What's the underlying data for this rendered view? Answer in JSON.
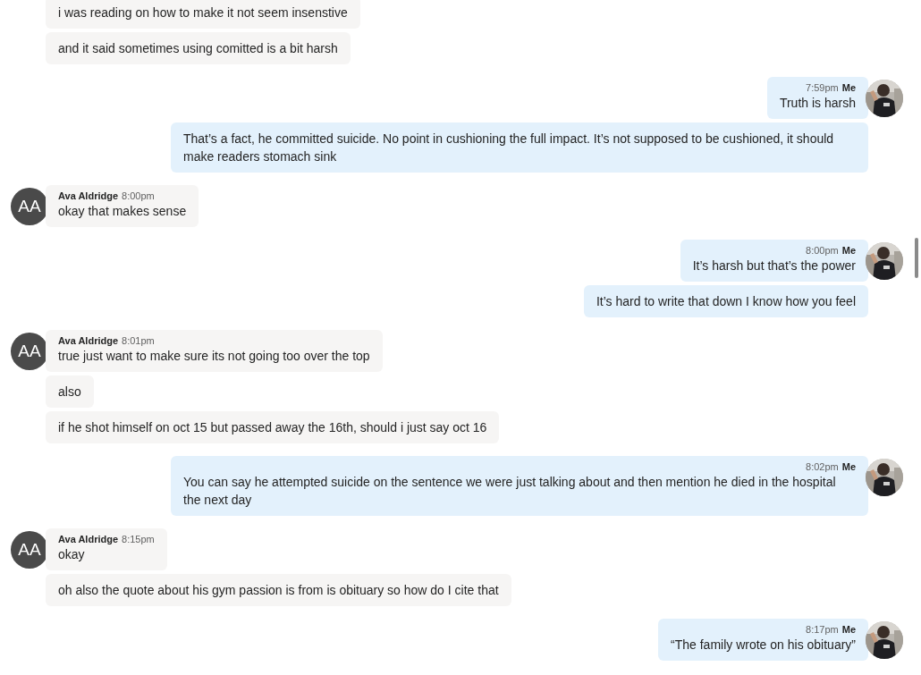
{
  "conversation": [
    {
      "kind": "them",
      "messages": [
        "i was reading on how to make it not seem insenstive",
        "and it said sometimes using comitted is a bit harsh"
      ]
    },
    {
      "kind": "me",
      "name": "Me",
      "time": "7:59pm",
      "messages": [
        "Truth is harsh",
        "That’s a fact, he committed suicide. No point in cushioning the full impact. It’s not supposed to be cushioned, it should make readers stomach sink"
      ]
    },
    {
      "kind": "them",
      "name": "Ava Aldridge",
      "initials": "AA",
      "time": "8:00pm",
      "messages": [
        "okay that makes sense"
      ]
    },
    {
      "kind": "me",
      "name": "Me",
      "time": "8:00pm",
      "messages": [
        "It’s harsh but that’s the power",
        "It’s hard to write that down I know how you feel"
      ]
    },
    {
      "kind": "them",
      "name": "Ava Aldridge",
      "initials": "AA",
      "time": "8:01pm",
      "messages": [
        "true just want to make sure its not going too over the top",
        "also",
        "if he shot himself on oct 15 but passed away the 16th, should i just say oct 16"
      ]
    },
    {
      "kind": "me",
      "name": "Me",
      "time": "8:02pm",
      "messages": [
        "You can say he attempted suicide on the sentence we were just talking about and then mention he died in the hospital the next day"
      ]
    },
    {
      "kind": "them",
      "name": "Ava Aldridge",
      "initials": "AA",
      "time": "8:15pm",
      "messages": [
        "okay",
        "oh also the quote about his gym passion is from is obituary so how do I cite that"
      ]
    },
    {
      "kind": "me",
      "name": "Me",
      "time": "8:17pm",
      "messages": [
        "“The family wrote on his obituary”"
      ]
    }
  ]
}
